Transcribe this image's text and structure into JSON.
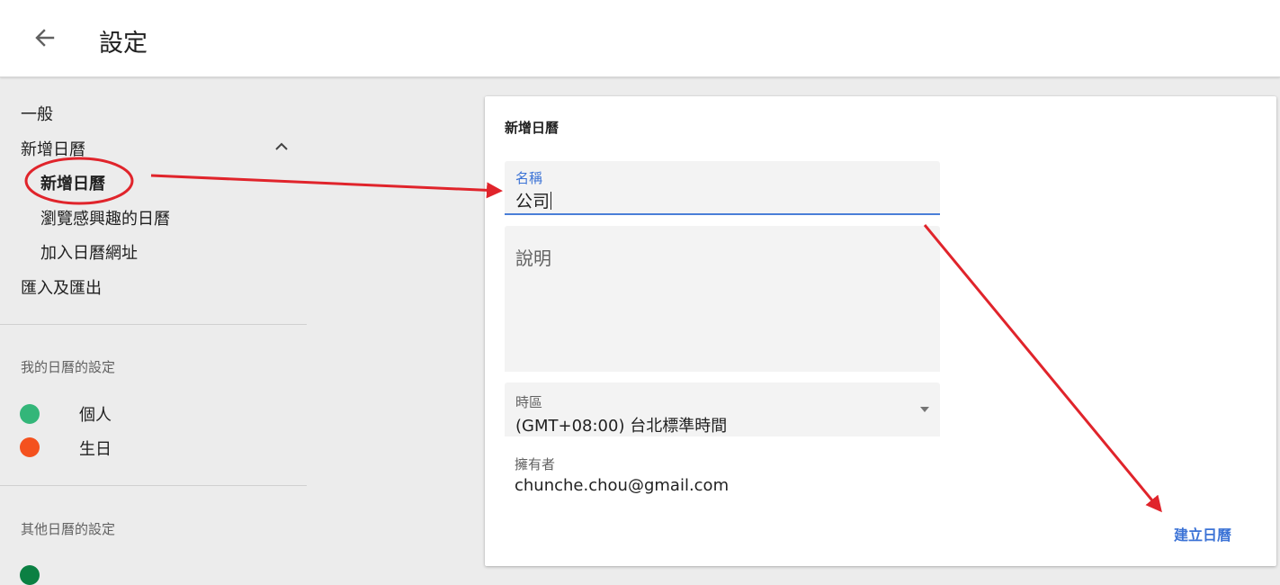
{
  "header": {
    "back_icon": "arrow-back-icon",
    "title": "設定"
  },
  "sidebar": {
    "items": [
      {
        "label": "一般"
      },
      {
        "label": "新增日曆",
        "expanded": true
      },
      {
        "label": "新增日曆",
        "active": true
      },
      {
        "label": "瀏覽感興趣的日曆"
      },
      {
        "label": "加入日曆網址"
      },
      {
        "label": "匯入及匯出"
      }
    ],
    "expand_icon": "chevron-up-icon",
    "my_calendars_heading": "我的日曆的設定",
    "my_calendars": [
      {
        "name": "個人",
        "color": "#33b679"
      },
      {
        "name": "生日",
        "color": "#f4511e"
      }
    ],
    "other_calendars_heading": "其他日曆的設定",
    "other_calendars_color": "#0b8043"
  },
  "form": {
    "title": "新增日曆",
    "name_label": "名稱",
    "name_value": "公司",
    "description_placeholder": "說明",
    "timezone_label": "時區",
    "timezone_value": "(GMT+08:00) 台北標準時間",
    "owner_label": "擁有者",
    "owner_value": "chunche.chou@gmail.com",
    "create_button": "建立日曆"
  },
  "annotation_color": "#e0242b",
  "accent_color": "#3c73d6"
}
